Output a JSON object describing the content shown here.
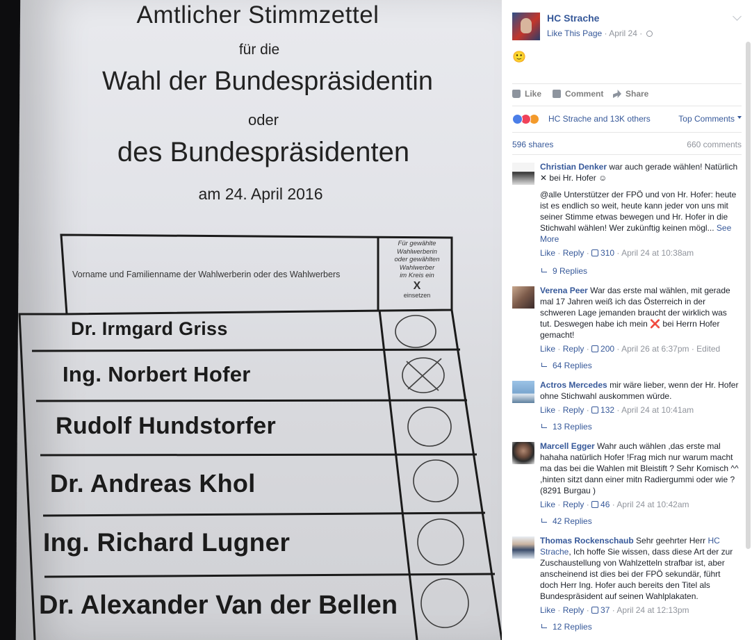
{
  "ballot": {
    "title": "Amtlicher Stimmzettel",
    "line_fuer": "für die",
    "line_wahl": "Wahl der Bundespräsidentin",
    "line_oder": "oder",
    "line_des": "des Bundespräsidenten",
    "line_date": "am 24. April 2016",
    "column_header": "Vorname und Familienname der Wahlwerberin oder des Wahlwerbers",
    "mark_header": [
      "Für gewählte",
      "Wahlwerberin",
      "oder gewählten",
      "Wahlwerber",
      "im Kreis ein"
    ],
    "mark_x": "X",
    "mark_einsetzen": "einsetzen",
    "candidates": [
      {
        "name": "Dr. Irmgard Griss",
        "marked": false
      },
      {
        "name": "Ing. Norbert Hofer",
        "marked": true
      },
      {
        "name": "Rudolf Hundstorfer",
        "marked": false
      },
      {
        "name": "Dr. Andreas Khol",
        "marked": false
      },
      {
        "name": "Ing. Richard Lugner",
        "marked": false
      },
      {
        "name": "Dr. Alexander Van der Bellen",
        "marked": false
      }
    ]
  },
  "post": {
    "page_name": "HC Strache",
    "like_page": "Like This Page",
    "date": "April 24",
    "emoji": "🙂",
    "actions": {
      "like": "Like",
      "comment": "Comment",
      "share": "Share"
    },
    "reactions_text": "HC Strache and 13K others",
    "top_comments": "Top Comments",
    "shares": "596 shares",
    "comments_count": "660 comments"
  },
  "comments": [
    {
      "author": "Christian Denker",
      "text1": "war auch gerade wählen! Natürlich ✕ bei Hr. Hofer ☺",
      "text2": "@alle Unterstützer der FPÖ und von Hr. Hofer: heute ist es endlich so weit, heute kann jeder von uns mit seiner Stimme etwas bewegen und Hr. Hofer in die Stichwahl wählen! Wer zukünftig keinen mögl...",
      "see_more": "See More",
      "like": "Like",
      "reply": "Reply",
      "likes": "310",
      "time": "April 24 at 10:38am",
      "replies": "9 Replies"
    },
    {
      "author": "Verena Peer",
      "text1": "War das erste mal wählen, mit gerade mal 17 Jahren weiß ich das Österreich in der schweren Lage jemanden braucht der wirklich was tut. Deswegen habe ich mein",
      "x_emoji": "❌",
      "text1b": "bei Herrn Hofer gemacht!",
      "like": "Like",
      "reply": "Reply",
      "likes": "200",
      "time": "April 26 at 6:37pm",
      "edited": "Edited",
      "replies": "64 Replies"
    },
    {
      "author": "Actros Mercedes",
      "text1": "mir wäre lieber, wenn der Hr. Hofer ohne Stichwahl auskommen würde.",
      "like": "Like",
      "reply": "Reply",
      "likes": "132",
      "time": "April 24 at 10:41am",
      "replies": "13 Replies"
    },
    {
      "author": "Marcell Egger",
      "text1": "Wahr auch wählen ,das erste mal hahaha natürlich Hofer !Frag mich nur warum macht ma das bei die Wahlen mit Bleistift ? Sehr Komisch ^^ ,hinten sitzt dann einer mitn Radiergummi oder wie ?(8291 Burgau )",
      "like": "Like",
      "reply": "Reply",
      "likes": "46",
      "time": "April 24 at 10:42am",
      "replies": "42 Replies"
    },
    {
      "author": "Thomas Rockenschaub",
      "text1": "Sehr geehrter Herr",
      "mention": "HC Strache",
      "text1b": ", Ich hoffe Sie wissen, dass diese Art der zur Zuschaustellung von Wahlzetteln strafbar ist, aber anscheinend ist dies bei der FPÖ sekundär, führt doch Herr Ing. Hofer auch bereits den Titel als Bundespräsident auf seinen Wahlplakaten.",
      "like": "Like",
      "reply": "Reply",
      "likes": "37",
      "time": "April 24 at 12:13pm",
      "replies": "12 Replies"
    }
  ],
  "colors": {
    "link": "#365899",
    "meta": "#90949c",
    "text": "#1d2129"
  }
}
